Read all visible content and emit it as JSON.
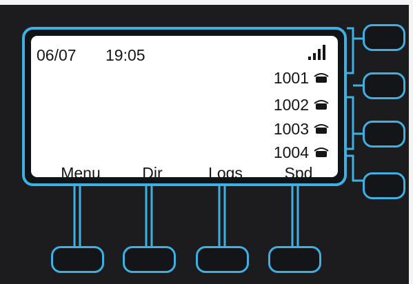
{
  "status": {
    "date": "06/07",
    "time": "19:05",
    "signal_icon": "signal-bars-icon"
  },
  "lines": [
    {
      "number": "1001",
      "icon": "handset-icon"
    },
    {
      "number": "1002",
      "icon": "handset-icon"
    },
    {
      "number": "1003",
      "icon": "handset-icon"
    },
    {
      "number": "1004",
      "icon": "handset-icon"
    }
  ],
  "softkeys": [
    {
      "label": "Menu"
    },
    {
      "label": "Dir"
    },
    {
      "label": "Logs"
    },
    {
      "label": "Spd"
    }
  ],
  "colors": {
    "accent": "#3fb0e3",
    "housing": "#1c1b1e",
    "display": "#ffffff",
    "text": "#151515"
  }
}
